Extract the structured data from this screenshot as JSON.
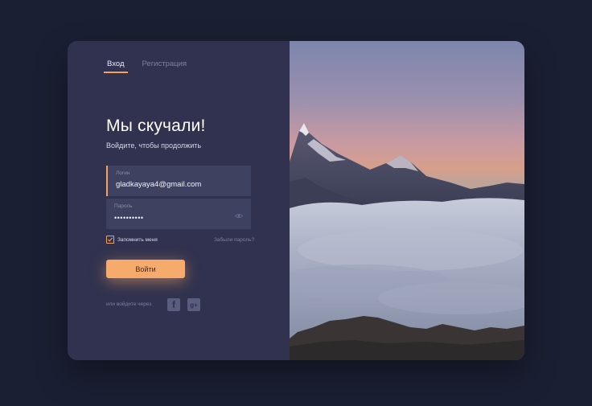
{
  "tabs": [
    {
      "label": "Вход",
      "active": true
    },
    {
      "label": "Регистрация",
      "active": false
    }
  ],
  "heading": {
    "title": "Мы скучали!",
    "subtitle": "Войдите, чтобы продолжить"
  },
  "form": {
    "login": {
      "label": "Логин",
      "value": "gladkayaya4@gmail.com"
    },
    "password": {
      "label": "Пароль",
      "value": "••••••••••"
    },
    "remember_label": "Запомнить меня",
    "remember_checked": true,
    "forgot_label": "Забыли пароль?",
    "submit_label": "Войти"
  },
  "social": {
    "label": "или войдите через",
    "facebook_glyph": "f",
    "google_plus_glyph": "g+"
  },
  "colors": {
    "background": "#1b1f33",
    "panel": "#30324f",
    "field": "#3f4161",
    "accent": "#f5a25d",
    "muted": "#7d80a3"
  },
  "icons": [
    "eye-icon",
    "checkmark-icon",
    "facebook-icon",
    "google-plus-icon"
  ]
}
